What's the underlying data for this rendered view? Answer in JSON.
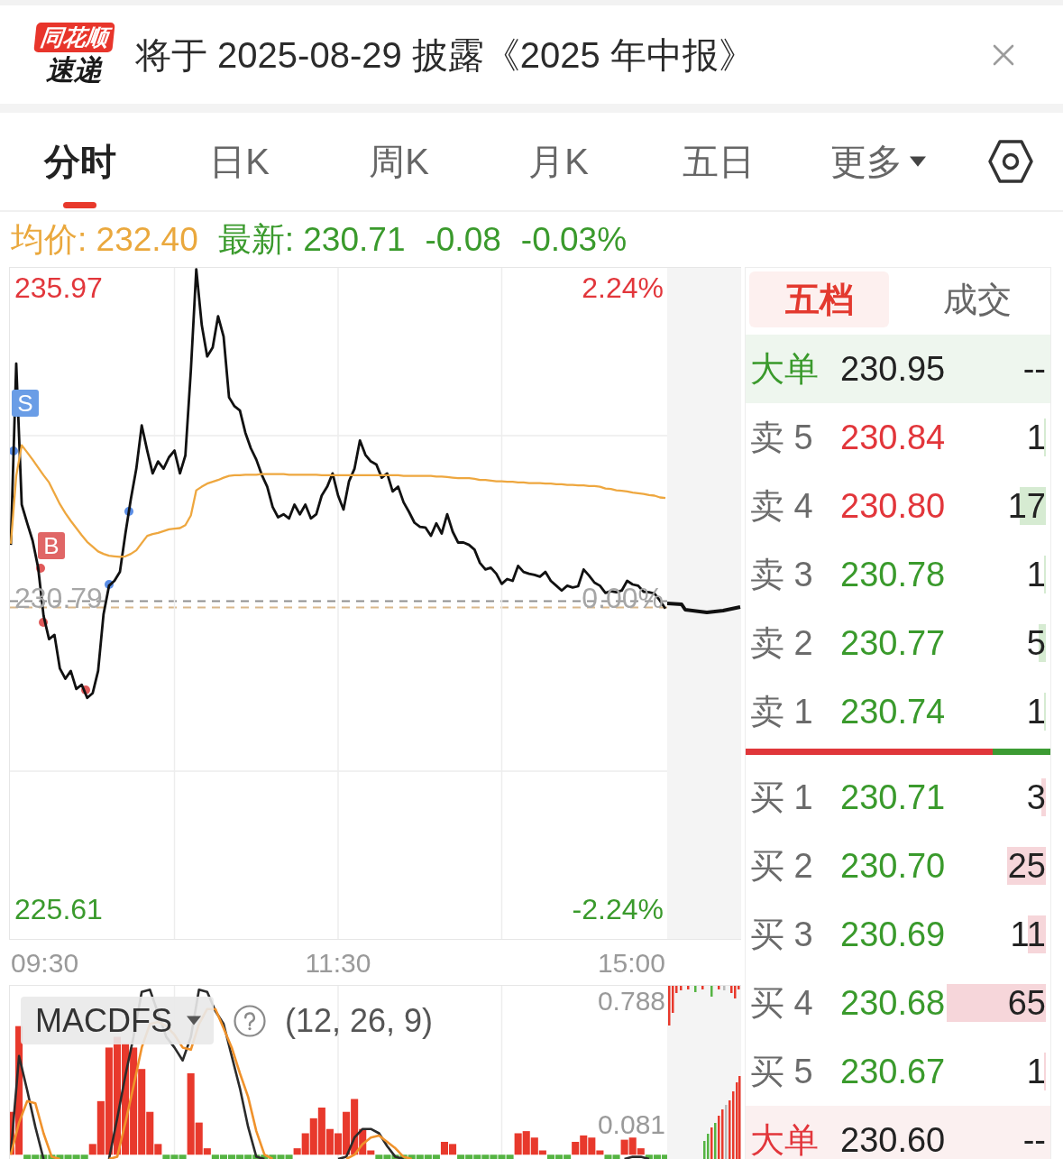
{
  "notice": {
    "logo": {
      "top": "同花顺",
      "bottom": "速递"
    },
    "title": "将于 2025-08-29 披露《2025 年中报》"
  },
  "tabs": [
    {
      "label": "分时",
      "kind": "tab",
      "selected": true
    },
    {
      "label": "日K",
      "kind": "tab",
      "selected": false
    },
    {
      "label": "周K",
      "kind": "tab",
      "selected": false
    },
    {
      "label": "月K",
      "kind": "tab",
      "selected": false
    },
    {
      "label": "五日",
      "kind": "tab",
      "selected": false
    },
    {
      "label": "更多",
      "kind": "menu",
      "selected": false
    }
  ],
  "quote": [
    {
      "text": "均价: 232.40",
      "color": "#eaa83d"
    },
    {
      "text": "最新: 230.71",
      "color": "#3a9a2c"
    },
    {
      "text": "-0.08",
      "color": "#3a9a2c"
    },
    {
      "text": "-0.03%",
      "color": "#3a9a2c"
    }
  ],
  "chart": {
    "percent_labels": [
      {
        "label": "2.24%",
        "color": "#e2363b"
      },
      {
        "label": "0.00%",
        "color": "#a6a6a6"
      },
      {
        "label": "-2.24%",
        "color": "#3a9a2c"
      }
    ],
    "trade_flags": [
      {
        "label": "S",
        "color": "#6a9de6"
      },
      {
        "label": "B",
        "color": "#e06666"
      }
    ],
    "trade_dots": [
      {
        "color": "#5b8ee6"
      },
      {
        "color": "#e05a5a"
      },
      {
        "color": "#e05a5a"
      },
      {
        "color": "#e05a5a"
      },
      {
        "color": "#5b8ee6"
      },
      {
        "color": "#5b8ee6"
      }
    ],
    "chart_data": {
      "type": "line",
      "grid": true,
      "ylim": [
        225.13,
        236.28
      ],
      "yticks": [
        {
          "value": 235.97,
          "label": "235.97"
        },
        {
          "value": 230.79,
          "label": "230.79"
        },
        {
          "value": 225.61,
          "label": "225.61"
        }
      ],
      "categories": [
        null,
        null,
        null,
        null,
        null,
        null,
        null,
        null,
        null,
        null,
        null,
        null,
        null,
        null,
        null,
        null,
        null,
        null,
        null,
        null,
        null,
        null,
        null,
        null,
        null,
        null,
        null,
        null,
        null,
        null,
        null,
        null,
        null,
        null,
        null,
        null,
        null,
        null,
        null,
        null,
        null,
        null,
        null,
        null,
        null,
        null,
        null,
        null,
        null,
        null,
        null,
        null,
        null,
        null,
        null,
        null,
        null,
        null,
        null,
        null,
        null,
        null,
        null,
        null,
        null,
        null,
        null,
        null,
        null,
        null,
        null,
        null,
        null,
        null,
        null,
        null,
        null,
        null,
        null,
        null,
        null,
        null,
        null,
        null,
        null,
        null,
        null,
        null,
        null,
        null,
        null,
        null,
        null,
        null,
        null,
        null,
        null,
        null,
        null,
        null,
        null,
        null,
        null,
        null,
        null,
        null,
        null,
        null,
        null,
        null,
        null,
        null,
        null,
        null,
        null,
        null,
        null,
        null,
        null,
        null,
        null
      ],
      "series": [
        {
          "color": "#111111",
          "values": [
            231.68,
            234.7,
            232.35,
            232.04,
            231.75,
            231.3,
            230.5,
            230.11,
            230.18,
            229.62,
            229.45,
            229.58,
            229.28,
            229.35,
            229.13,
            229.21,
            229.58,
            230.52,
            231.0,
            231.08,
            231.23,
            231.87,
            232.44,
            232.95,
            233.67,
            233.25,
            232.87,
            233.07,
            232.95,
            233.14,
            233.25,
            232.87,
            233.17,
            234.59,
            236.27,
            235.34,
            234.82,
            234.97,
            235.49,
            235.15,
            234.14,
            233.99,
            233.92,
            233.55,
            233.29,
            233.1,
            232.85,
            232.65,
            232.31,
            232.14,
            232.19,
            232.12,
            232.35,
            232.19,
            232.35,
            232.12,
            232.19,
            232.5,
            232.65,
            232.87,
            232.5,
            232.27,
            232.74,
            232.95,
            233.42,
            233.18,
            233.07,
            233.02,
            232.8,
            232.87,
            232.57,
            232.65,
            232.39,
            232.23,
            232.05,
            231.98,
            231.97,
            231.83,
            232.04,
            231.87,
            232.19,
            231.9,
            231.72,
            231.72,
            231.68,
            231.6,
            231.38,
            231.27,
            231.3,
            231.2,
            231.03,
            231.11,
            231.08,
            231.33,
            231.23,
            231.2,
            231.18,
            231.15,
            231.23,
            231.08,
            231.0,
            230.92,
            231.0,
            230.97,
            230.99,
            231.27,
            231.17,
            231.05,
            231.0,
            230.88,
            230.91,
            230.89,
            230.92,
            231.08,
            231.02,
            231.0,
            230.9,
            230.89,
            230.87,
            230.75,
            230.62
          ]
        },
        {
          "color": "#eea73f",
          "values": [
            231.7,
            232.83,
            233.34,
            233.22,
            233.1,
            232.97,
            232.84,
            232.72,
            232.54,
            232.36,
            232.21,
            232.08,
            231.96,
            231.84,
            231.73,
            231.65,
            231.57,
            231.53,
            231.5,
            231.49,
            231.48,
            231.49,
            231.53,
            231.59,
            231.71,
            231.83,
            231.86,
            231.88,
            231.91,
            231.94,
            231.95,
            231.96,
            232.01,
            232.17,
            232.59,
            232.65,
            232.7,
            232.73,
            232.76,
            232.8,
            232.83,
            232.84,
            232.84,
            232.85,
            232.85,
            232.85,
            232.86,
            232.86,
            232.86,
            232.86,
            232.86,
            232.85,
            232.85,
            232.85,
            232.85,
            232.85,
            232.85,
            232.84,
            232.84,
            232.84,
            232.84,
            232.84,
            232.84,
            232.84,
            232.84,
            232.84,
            232.84,
            232.84,
            232.84,
            232.84,
            232.84,
            232.84,
            232.83,
            232.83,
            232.83,
            232.83,
            232.83,
            232.83,
            232.82,
            232.82,
            232.81,
            232.8,
            232.79,
            232.79,
            232.79,
            232.78,
            232.76,
            232.76,
            232.75,
            232.74,
            232.74,
            232.73,
            232.73,
            232.72,
            232.72,
            232.71,
            232.71,
            232.71,
            232.7,
            232.7,
            232.69,
            232.69,
            232.68,
            232.68,
            232.67,
            232.67,
            232.66,
            232.66,
            232.65,
            232.62,
            232.61,
            232.59,
            232.58,
            232.57,
            232.55,
            232.54,
            232.53,
            232.51,
            232.5,
            232.47,
            232.46
          ]
        }
      ]
    }
  },
  "time_labels": [
    "09:30",
    "11:30",
    "15:00"
  ],
  "indicator": {
    "name": "MACDFS",
    "params": "(12, 26, 9)",
    "scale_labels": [
      "0.788",
      "0.081"
    ]
  },
  "order_book": {
    "tabs": [
      {
        "label": "五档",
        "selected": true
      },
      {
        "label": "成交",
        "selected": false
      }
    ],
    "asks": {
      "big": {
        "label": "大单",
        "price": "230.95",
        "volume": "--"
      },
      "levels": [
        {
          "label": "卖 5",
          "price": "230.84",
          "volume": "1",
          "color": "#e2363b",
          "level": 0.006
        },
        {
          "label": "卖 4",
          "price": "230.80",
          "volume": "17",
          "color": "#e2363b",
          "level": 0.087
        },
        {
          "label": "卖 3",
          "price": "230.78",
          "volume": "1",
          "color": "#3a9a2c",
          "level": 0.006
        },
        {
          "label": "卖 2",
          "price": "230.77",
          "volume": "5",
          "color": "#3a9a2c",
          "level": 0.024
        },
        {
          "label": "卖 1",
          "price": "230.74",
          "volume": "1",
          "color": "#3a9a2c",
          "level": 0.006
        }
      ]
    },
    "ratio": {
      "level": 0.81
    },
    "bids": {
      "levels": [
        {
          "label": "买 1",
          "price": "230.71",
          "volume": "3",
          "color": "#3a9a2c",
          "level": 0.015
        },
        {
          "label": "买 2",
          "price": "230.70",
          "volume": "25",
          "color": "#3a9a2c",
          "level": 0.129
        },
        {
          "label": "买 3",
          "price": "230.69",
          "volume": "11",
          "color": "#3a9a2c",
          "level": 0.06
        },
        {
          "label": "买 4",
          "price": "230.68",
          "volume": "65",
          "color": "#3a9a2c",
          "level": 0.33
        },
        {
          "label": "买 5",
          "price": "230.67",
          "volume": "1",
          "color": "#3a9a2c",
          "level": 0.006
        }
      ],
      "big": {
        "label": "大单",
        "price": "230.60",
        "volume": "--"
      }
    }
  }
}
